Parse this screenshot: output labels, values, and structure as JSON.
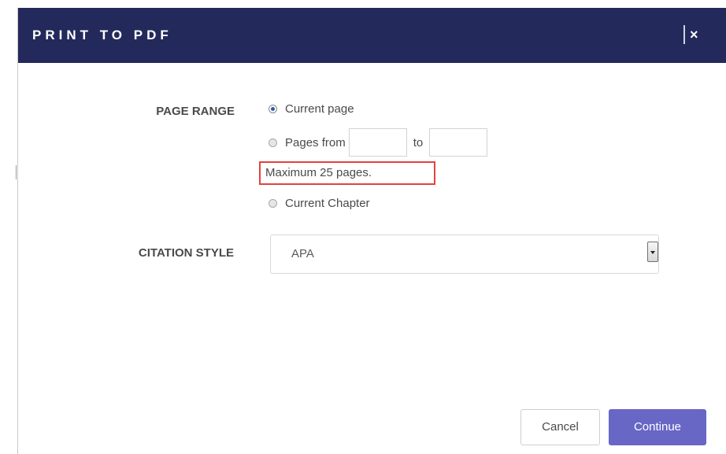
{
  "dialog": {
    "title": "PRINT TO PDF",
    "close_label": "×"
  },
  "page_range": {
    "label": "PAGE RANGE",
    "options": [
      {
        "label": "Current page",
        "checked": true
      },
      {
        "label": "Pages from",
        "checked": false
      },
      {
        "label": "Current Chapter",
        "checked": false
      }
    ],
    "from_value": "",
    "to_label": "to",
    "to_value": "",
    "max_note": "Maximum 25 pages."
  },
  "citation_style": {
    "label": "CITATION STYLE",
    "selected": "APA"
  },
  "buttons": {
    "cancel": "Cancel",
    "continue": "Continue"
  },
  "colors": {
    "header_bg": "#24295c",
    "primary_button": "#6867c6",
    "highlight_border": "#e0433d"
  }
}
